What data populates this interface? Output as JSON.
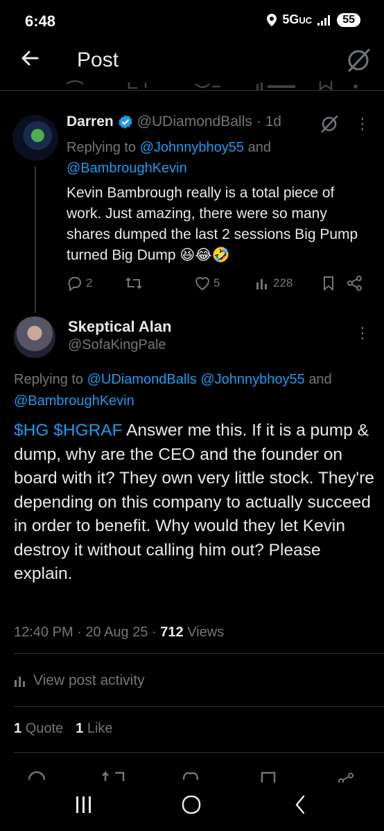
{
  "status_bar": {
    "time": "6:48",
    "network": "5G",
    "network_suffix": "UC",
    "battery": "55"
  },
  "header": {
    "title": "Post"
  },
  "reply_tweet": {
    "name": "Darren",
    "handle": "@UDiamondBalls",
    "age": "· 1d",
    "replying_prefix": "Replying to",
    "replying_to_1": "@Johnnybhoy55",
    "replying_and": "and",
    "replying_to_2": "@BambroughKevin",
    "text": "Kevin Bambrough really is a total piece of work. Just amazing, there were so many shares dumped the last 2 sessions Big Pump turned Big Dump 😆😂🤣",
    "replies": "2",
    "likes": "5",
    "views": "228"
  },
  "main_tweet": {
    "name": "Skeptical Alan",
    "handle": "@SofaKingPale",
    "replying_prefix": "Replying to",
    "replying_to_1": "@UDiamondBalls",
    "replying_to_2": "@Johnnybhoy55",
    "replying_and": "and",
    "replying_to_3": "@BambroughKevin",
    "cashtag_1": "$HG",
    "cashtag_2": "$HGRAF",
    "text": "Answer me this. If it is a pump & dump, why are the CEO and the founder on board with it? They own very little stock. They're depending on this company to actually succeed in order to benefit. Why would they let Kevin destroy it without calling him out? Please explain.",
    "time": "12:40 PM",
    "date": "20 Aug 25",
    "views_count": "712",
    "views_label": "Views",
    "view_activity_label": "View post activity",
    "quotes_count": "1",
    "quotes_label": "Quote",
    "likes_count": "1",
    "likes_label": "Like"
  },
  "colors": {
    "accent": "#1d9bf0",
    "muted": "#71767b",
    "background": "#000000",
    "text": "#e7e9ea"
  }
}
